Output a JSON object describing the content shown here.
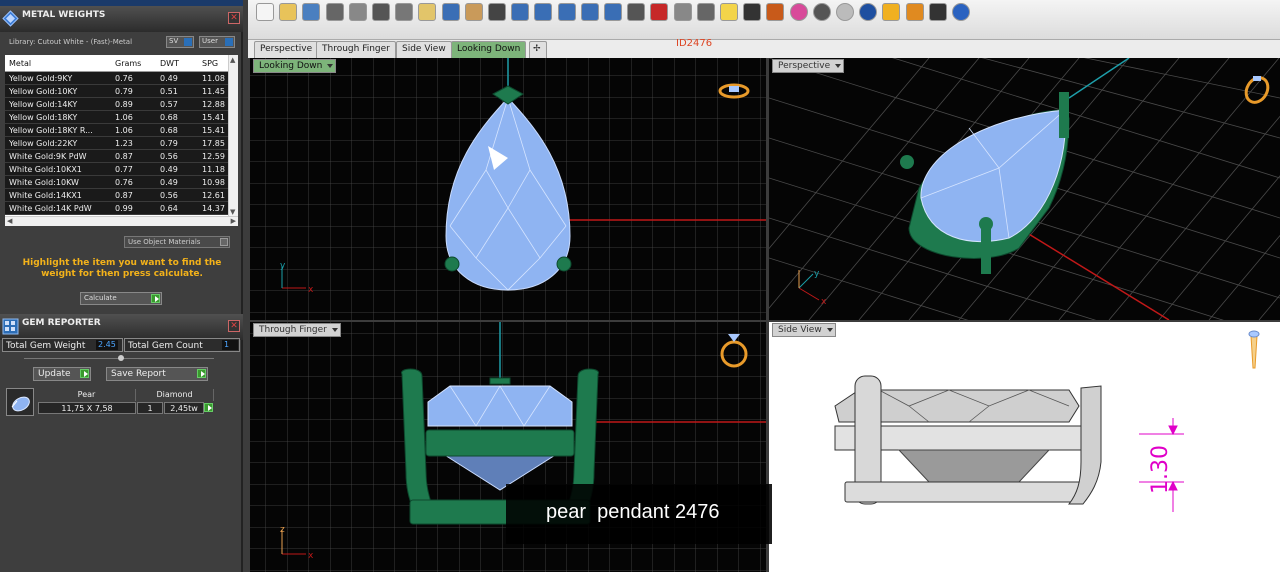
{
  "colors": {
    "accent_green": "#7db47a",
    "hint_orange": "#f3b21a",
    "doc_id_red": "#d42",
    "gem_blue": "#8fb4f2",
    "prong_green": "#1e7a4e"
  },
  "metal_weights": {
    "title": "METAL WEIGHTS",
    "icon": "metal-weights-icon",
    "library_label": "Library: Cutout White - (Fast)-Metal",
    "sg_button": "SV",
    "user_button": "User",
    "columns": [
      "Metal",
      "Grams",
      "DWT",
      "SPG"
    ],
    "rows": [
      [
        "Yellow Gold:9KY",
        "0.76",
        "0.49",
        "11.08"
      ],
      [
        "Yellow Gold:10KY",
        "0.79",
        "0.51",
        "11.45"
      ],
      [
        "Yellow Gold:14KY",
        "0.89",
        "0.57",
        "12.88"
      ],
      [
        "Yellow Gold:18KY",
        "1.06",
        "0.68",
        "15.41"
      ],
      [
        "Yellow Gold:18KY R...",
        "1.06",
        "0.68",
        "15.41"
      ],
      [
        "Yellow Gold:22KY",
        "1.23",
        "0.79",
        "17.85"
      ],
      [
        "White Gold:9K PdW",
        "0.87",
        "0.56",
        "12.59"
      ],
      [
        "White Gold:10KX1",
        "0.77",
        "0.49",
        "11.18"
      ],
      [
        "White Gold:10KW",
        "0.76",
        "0.49",
        "10.98"
      ],
      [
        "White Gold:14KX1",
        "0.87",
        "0.56",
        "12.61"
      ],
      [
        "White Gold:14K PdW",
        "0.99",
        "0.64",
        "14.37"
      ]
    ],
    "use_object_materials": "Use Object Materials",
    "hint": "Highlight the item you want to find the weight for then press calculate.",
    "calculate_label": "Calculate"
  },
  "gem_reporter": {
    "title": "GEM REPORTER",
    "icon": "gem-reporter-icon",
    "total_weight_label": "Total Gem Weight",
    "total_weight_value": "2.45",
    "total_count_label": "Total Gem Count",
    "total_count_value": "1",
    "update_label": "Update",
    "save_report_label": "Save Report",
    "table_headers": [
      "Pear",
      "Diamond"
    ],
    "gem": {
      "size": "11,75 X 7,58",
      "qty": "1",
      "weight": "2,45tw"
    }
  },
  "toolbar": {
    "icons": [
      "new-file-icon",
      "open-folder-icon",
      "save-icon",
      "print-icon",
      "copy-doc-icon",
      "cut-icon",
      "copy-icon",
      "paste-icon",
      "undo-icon",
      "pan-hand-icon",
      "move-icon",
      "zoom-icon",
      "zoom-window-icon",
      "zoom-extents-icon",
      "zoom-selected-icon",
      "rotate-icon",
      "grid-view-icon",
      "ruler-icon",
      "measure-icon",
      "clock-icon",
      "light-icon",
      "lock-icon",
      "material-icon",
      "color-wheel-icon",
      "sphere-dark-icon",
      "sphere-light-icon",
      "globe-icon",
      "flag-icon",
      "settings-gears-icon",
      "layout-icon",
      "help-icon"
    ]
  },
  "tabs": [
    {
      "label": "Perspective",
      "active": false
    },
    {
      "label": "Through Finger",
      "active": false
    },
    {
      "label": "Side View",
      "active": false
    },
    {
      "label": "Looking Down",
      "active": true
    }
  ],
  "document_id": "ID2476",
  "viewports": {
    "top_left": {
      "label": "Looking Down",
      "active": true,
      "axis_x": "x",
      "axis_y": "y"
    },
    "top_right": {
      "label": "Perspective",
      "active": false,
      "axis_x": "x",
      "axis_y": "y"
    },
    "bottom_left": {
      "label": "Through Finger",
      "active": false,
      "axis_x": "x",
      "axis_y": "z"
    },
    "bottom_right": {
      "label": "Side View",
      "active": false,
      "dimension": "1.30"
    }
  },
  "caption": "pear  pendant 2476"
}
